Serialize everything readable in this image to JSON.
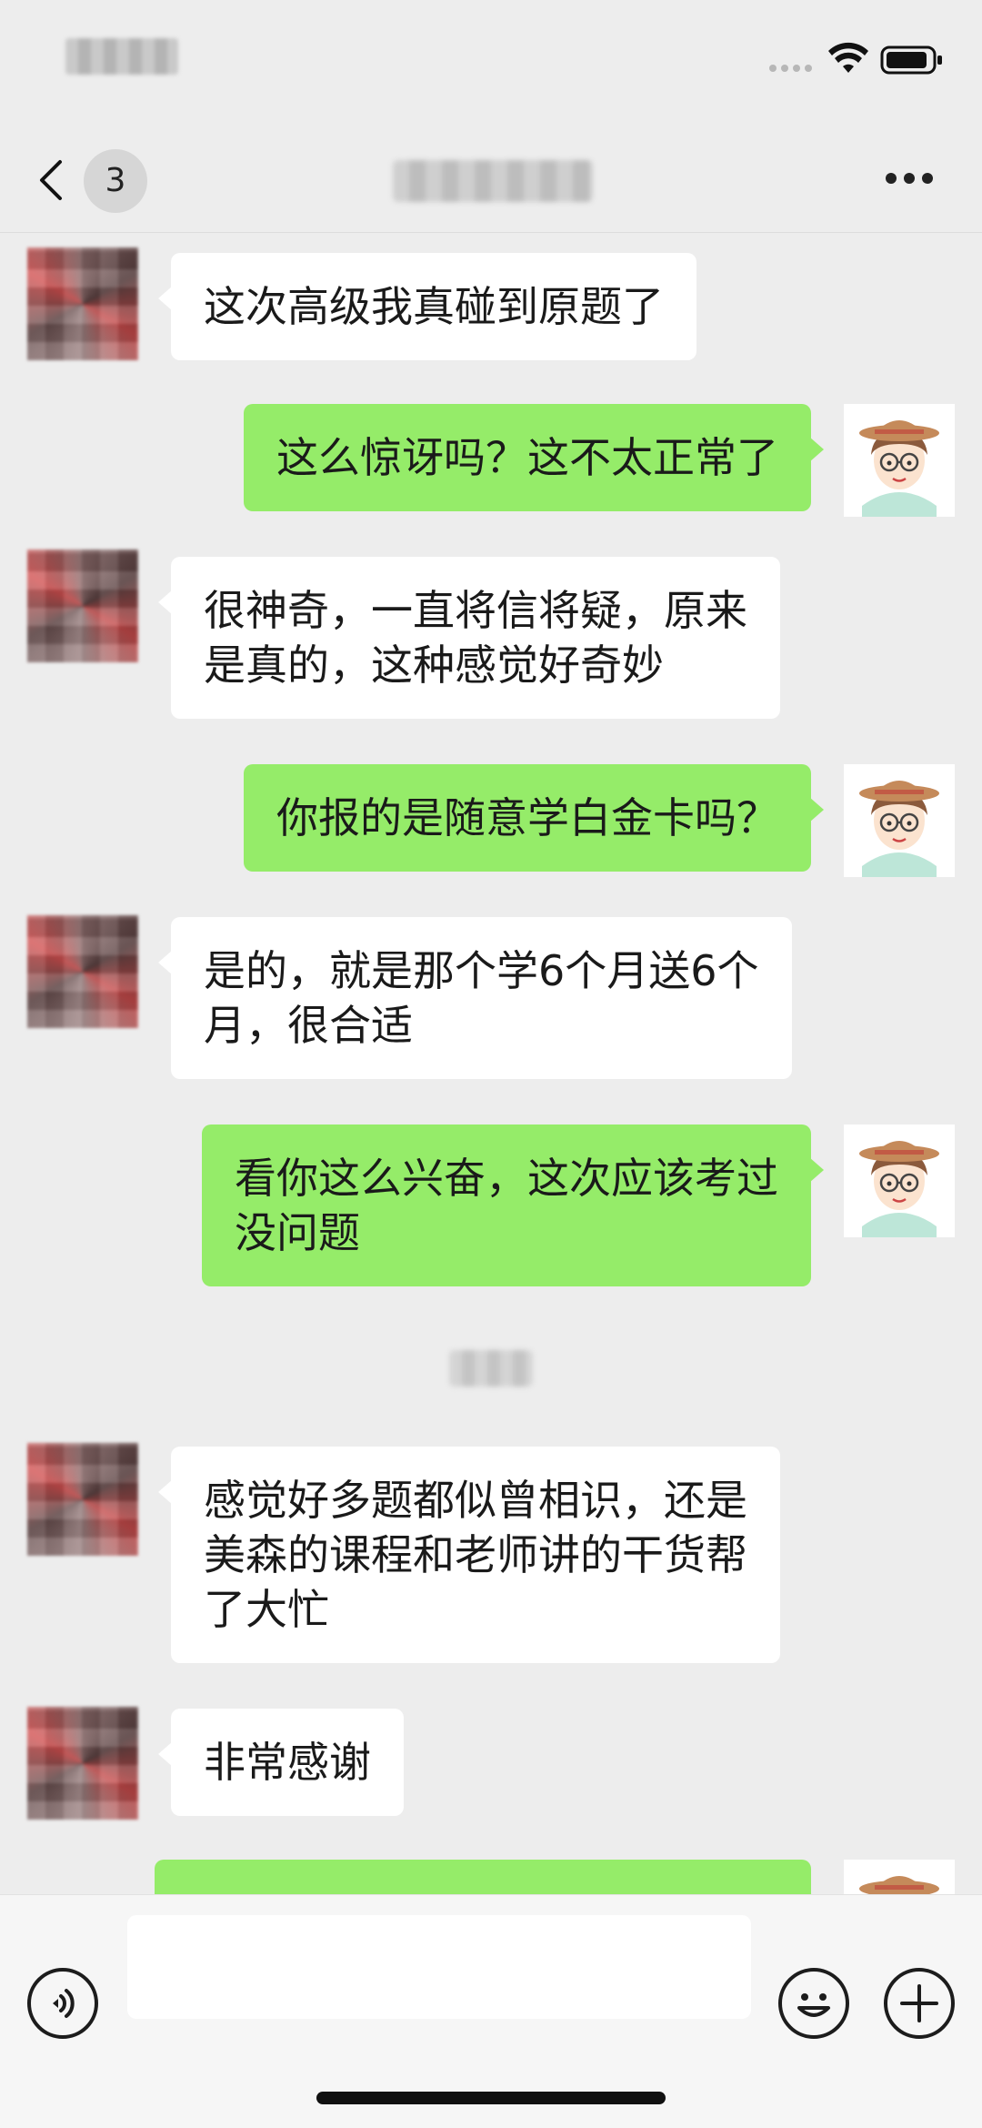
{
  "nav": {
    "unread_count": "3",
    "title": ""
  },
  "messages": [
    {
      "side": "left",
      "text": "这次高级我真碰到原题了"
    },
    {
      "side": "right",
      "text": "这么惊讶吗？这不太正常了"
    },
    {
      "side": "left",
      "text": "很神奇，一直将信将疑，原来\n是真的，这种感觉好奇妙"
    },
    {
      "side": "right",
      "text": "你报的是随意学白金卡吗？"
    },
    {
      "side": "left",
      "text": "是的，就是那个学6个月送6个\n月，很合适"
    },
    {
      "side": "right",
      "text": "看你这么兴奋，这次应该考过\n没问题"
    },
    {
      "side": "left",
      "text": "感觉好多题都似曾相识，还是\n美森的课程和老师讲的干货帮\n了大忙"
    },
    {
      "side": "left",
      "text": "非常感谢"
    },
    {
      "side": "right",
      "text": ""
    }
  ],
  "input": {
    "value": "",
    "placeholder": ""
  },
  "colors": {
    "background": "#ededed",
    "incoming_bubble": "#ffffff",
    "outgoing_bubble": "#95ec69"
  },
  "icons": [
    "back-chevron-icon",
    "more-icon",
    "voice-icon",
    "emoji-icon",
    "plus-icon",
    "wifi-icon",
    "battery-icon"
  ]
}
